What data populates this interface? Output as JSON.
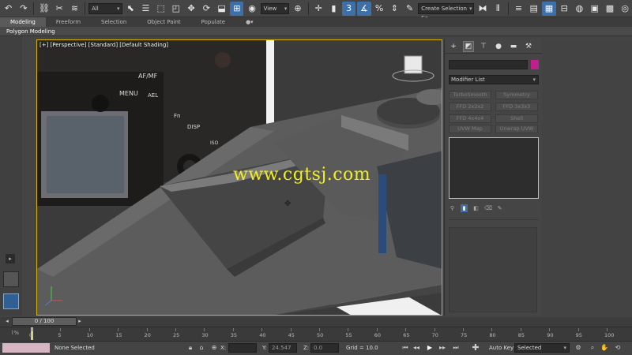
{
  "toolbar": {
    "filter_value": "All",
    "refcoord_value": "View",
    "named_selection_placeholder": "Create Selection Se"
  },
  "ribbon": {
    "tabs": [
      "Modeling",
      "Freeform",
      "Selection",
      "Object Paint",
      "Populate"
    ],
    "active_tab": "Modeling",
    "sub_label": "Polygon Modeling"
  },
  "viewport": {
    "label": "[+] [Perspective] [Standard] [Default Shading]",
    "camera_labels": [
      "AF/MF",
      "MENU",
      "AEL",
      "Fn",
      "DISP",
      "ISO"
    ],
    "watermark": "www.cgtsj.com"
  },
  "command_panel": {
    "modifier_list_label": "Modifier List",
    "modifier_buttons": [
      "TurboSmooth",
      "Symmetry",
      "FFD 2x2x2",
      "FFD 3x3x3",
      "FFD 4x4x4",
      "Shell",
      "UVW Map",
      "Unwrap UVW"
    ],
    "object_color": "#c0208f"
  },
  "timeline": {
    "frame_readout": "0 / 100",
    "tick_labels": [
      "0",
      "5",
      "10",
      "15",
      "20",
      "25",
      "30",
      "35",
      "40",
      "45",
      "50",
      "55",
      "60",
      "65",
      "70",
      "75",
      "80",
      "85",
      "90",
      "95",
      "100"
    ]
  },
  "status": {
    "selection_text": "None Selected",
    "x_label": "X:",
    "y_label": "Y:",
    "y_value": "24.547",
    "z_label": "Z:",
    "z_value": "0.0",
    "grid_text": "Grid = 10.0",
    "autokey_label": "Auto Key",
    "selected_dropdown": "Selected"
  },
  "colors": {
    "active_blue": "#3d6fa8",
    "viewport_border": "#d8b400",
    "watermark": "#f2ef1c"
  }
}
